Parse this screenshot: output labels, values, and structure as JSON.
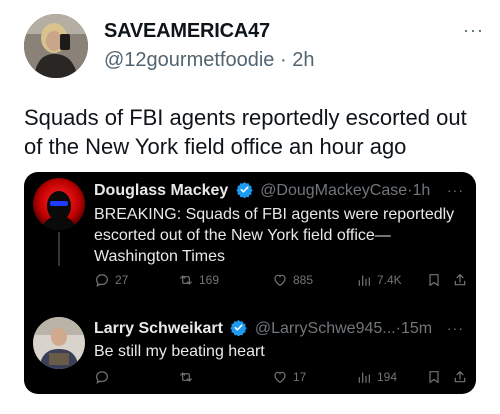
{
  "post": {
    "author_name": "SAVEAMERICA47",
    "handle": "@12gourmetfoodie",
    "separator": "·",
    "time": "2h",
    "more": "···",
    "text": "Squads of FBI agents reportedly escorted out of the New York field office an hour ago"
  },
  "quoted": [
    {
      "name": "Douglass Mackey",
      "handle": "@DougMackeyCase",
      "separator": "·",
      "time": "1h",
      "more": "···",
      "text": "BREAKING: Squads of FBI agents were reportedly escorted out of the New York field office—Washington Times",
      "actions": {
        "reply": "27",
        "retweet": "169",
        "like": "885",
        "views": "7.4K"
      }
    },
    {
      "name": "Larry Schweikart",
      "handle": "@LarrySchwe945...",
      "separator": "·",
      "time": "15m",
      "more": "···",
      "text": "Be still my beating heart",
      "actions": {
        "reply": "",
        "retweet": "",
        "like": "17",
        "views": "194"
      }
    }
  ],
  "colors": {
    "verified": "#1d9bf0",
    "card_bg": "#000000",
    "muted": "#71767b"
  }
}
